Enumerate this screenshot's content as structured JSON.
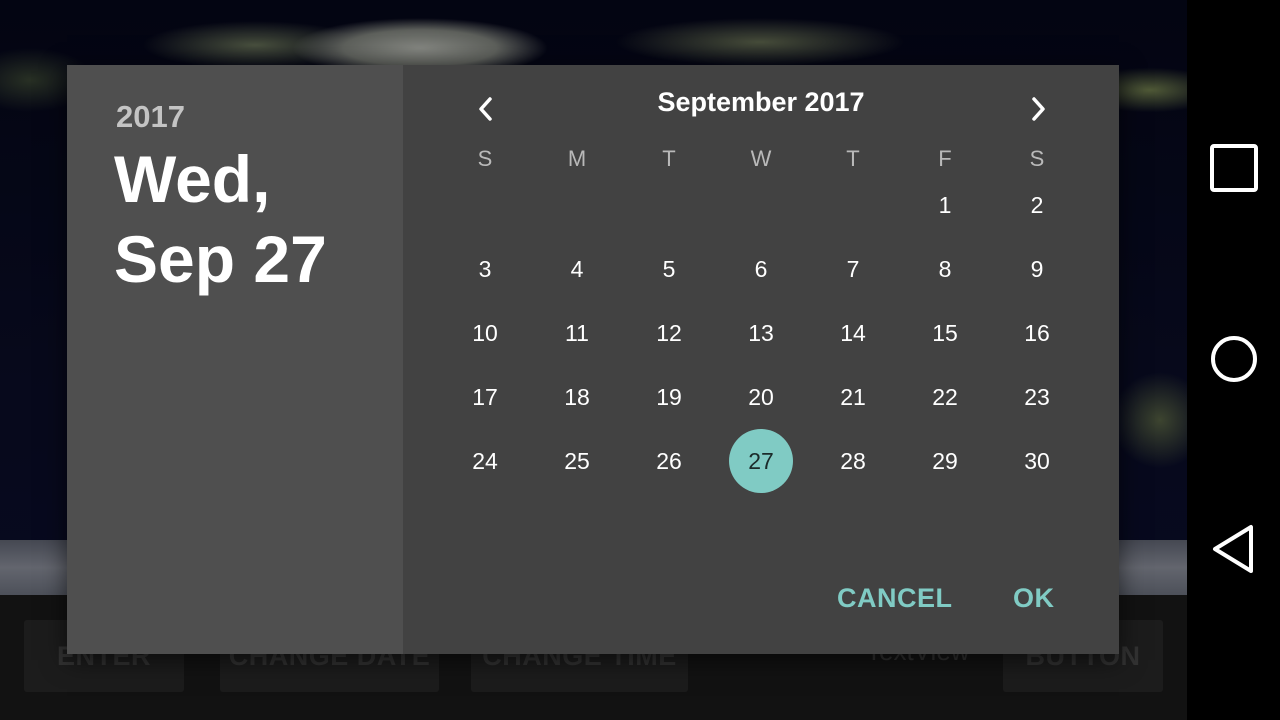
{
  "background_app": {
    "buttons": [
      "ENTER",
      "CHANGE DATE",
      "CHANGE TIME",
      "BUTTON"
    ],
    "textview": "TextView"
  },
  "date_picker": {
    "header": {
      "year": "2017",
      "date_line1": "Wed,",
      "date_line2": "Sep 27"
    },
    "month_title": "September 2017",
    "weekdays": [
      "S",
      "M",
      "T",
      "W",
      "T",
      "F",
      "S"
    ],
    "first_weekday_index": 5,
    "days_in_month": 30,
    "selected_day": 27,
    "actions": {
      "cancel": "CANCEL",
      "ok": "OK"
    },
    "accent_color": "#80cbc4",
    "header_bg": "#4f4f4f",
    "panel_bg": "#424242",
    "prev_icon": "chevron-left-icon",
    "next_icon": "chevron-right-icon"
  },
  "system_nav": {
    "icons": [
      "recents-square-icon",
      "home-circle-icon",
      "back-triangle-icon"
    ]
  }
}
